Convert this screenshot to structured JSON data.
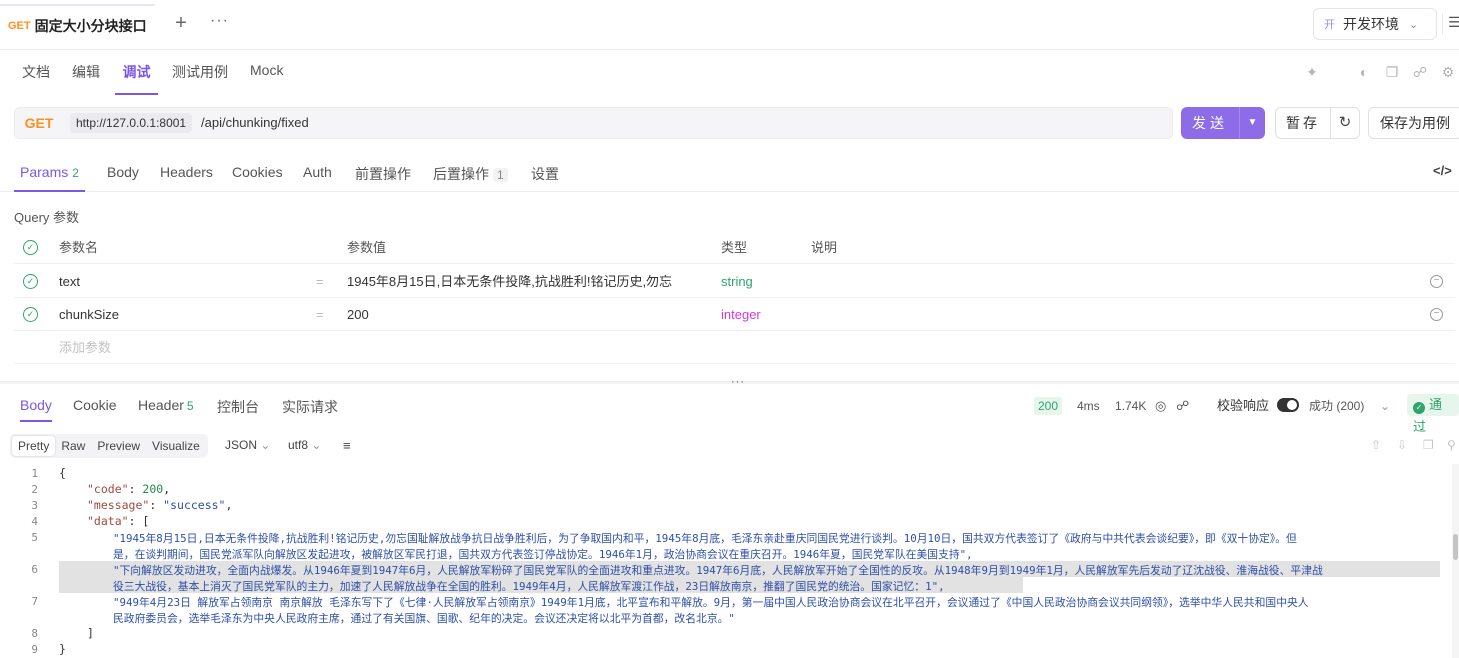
{
  "tab": {
    "method": "GET",
    "title": "固定大小分块接口",
    "add": "+",
    "more": "···"
  },
  "env": {
    "badge": "开",
    "name": "开发环境"
  },
  "docnav": {
    "items": [
      "文档",
      "编辑",
      "调试",
      "测试用例",
      "Mock"
    ],
    "active": "调试"
  },
  "request": {
    "method": "GET",
    "host": "http://127.0.0.1:8001",
    "path": "/api/chunking/fixed",
    "send_label": "发送",
    "stash_label": "暂存",
    "save_case_label": "保存为用例"
  },
  "req_tabs": {
    "params": "Params",
    "params_count": "2",
    "body": "Body",
    "headers": "Headers",
    "cookies": "Cookies",
    "auth": "Auth",
    "pre": "前置操作",
    "post": "后置操作",
    "post_count": "1",
    "settings": "设置"
  },
  "query": {
    "title": "Query 参数",
    "headers": {
      "name": "参数名",
      "value": "参数值",
      "type": "类型",
      "desc": "说明"
    },
    "rows": [
      {
        "name": "text",
        "value": "1945年8月15日,日本无条件投降,抗战胜利!铭记历史,勿忘",
        "type": "string"
      },
      {
        "name": "chunkSize",
        "value": "200",
        "type": "integer"
      }
    ],
    "add_placeholder": "添加参数"
  },
  "resp_tabs": {
    "body": "Body",
    "cookie": "Cookie",
    "header": "Header",
    "header_count": "5",
    "console": "控制台",
    "actual": "实际请求"
  },
  "resp_meta": {
    "status": "200",
    "time": "4ms",
    "size": "1.74K",
    "validate_label": "校验响应",
    "success_label": "成功 (200)",
    "pass_label": "通过"
  },
  "view": {
    "modes": [
      "Pretty",
      "Raw",
      "Preview",
      "Visualize"
    ],
    "active": "Pretty",
    "format": "JSON",
    "encoding": "utf8"
  },
  "code": {
    "line_numbers": [
      "1",
      "2",
      "3",
      "4",
      "5",
      "6",
      "7",
      "8",
      "9"
    ],
    "open_brace": "{",
    "code_key": "\"code\"",
    "code_val": "200",
    "message_key": "\"message\"",
    "message_val": "\"success\"",
    "data_key": "\"data\"",
    "data_open": "[",
    "s1a": "\"1945年8月15日,日本无条件投降,抗战胜利!铭记历史,勿忘国耻解放战争抗日战争胜利后，为了争取国内和平，1945年8月底，毛泽东亲赴重庆同国民党进行谈判。10月10日，国共双方代表签订了《政府与中共代表会谈纪要》，即《双十协定》。但",
    "s1b": "是，在谈判期间，国民党派军队向解放区发起进攻，被解放区军民打退，国共双方代表签订停战协定。1946年1月，政治协商会议在重庆召开。1946年夏，国民党军队在美国支持\",",
    "s2a": "\"下向解放区发动进攻，全面内战爆发。从1946年夏到1947年6月，人民解放军粉碎了国民党军队的全面进攻和重点进攻。1947年6月底，人民解放军开始了全国性的反攻。从1948年9月到1949年1月，人民解放军先后发动了辽沈战役、淮海战役、平津战",
    "s2b": "役三大战役，基本上消灭了国民党军队的主力，加速了人民解放战争在全国的胜利。1949年4月，人民解放军渡江作战，23日解放南京，推翻了国民党的统治。国家记忆：1\",",
    "s3a": "\"949年4月23日 解放军占领南京 南京解放 毛泽东写下了《七律·人民解放军占领南京》1949年1月底，北平宣布和平解放。9月，第一届中国人民政治协商会议在北平召开，会议通过了《中国人民政治协商会议共同纲领》，选举中华人民共和国中央人",
    "s3b": "民政府委员会，选举毛泽东为中央人民政府主席，通过了有关国旗、国歌、纪年的决定。会议还决定将以北平为首都，改名北京。\"",
    "data_close": "]",
    "close_brace": "}"
  }
}
